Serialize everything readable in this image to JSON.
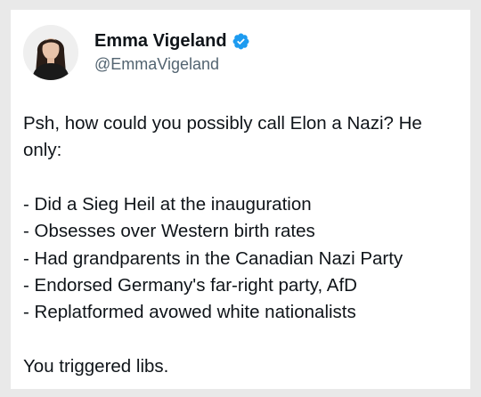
{
  "author": {
    "display_name": "Emma Vigeland",
    "handle": "@EmmaVigeland",
    "verified_icon": "verified-badge-icon",
    "verified_color": "#1d9bf0"
  },
  "tweet": {
    "intro": "Psh, how could you possibly call Elon a Nazi? He only:",
    "items": [
      "- Did a Sieg Heil at the inauguration",
      "- Obsesses over Western birth rates",
      "- Had grandparents in the Canadian Nazi Party",
      "- Endorsed Germany's far-right party, AfD",
      "- Replatformed avowed white nationalists"
    ],
    "outro": "You triggered libs."
  }
}
